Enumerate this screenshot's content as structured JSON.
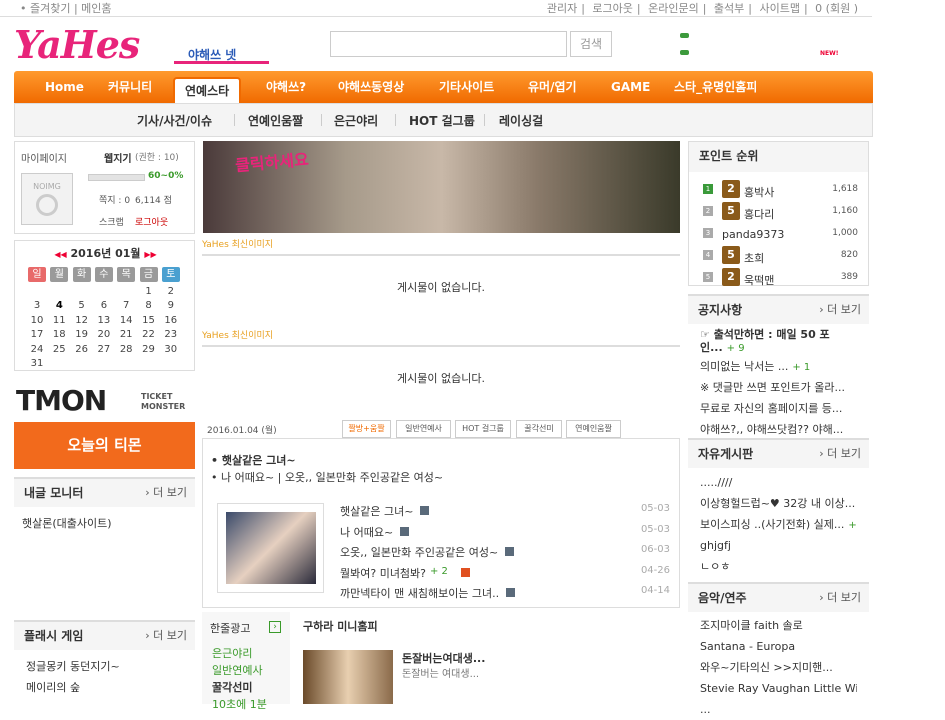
{
  "topbar": {
    "left": "• 즐겨찾기 | 메인홈",
    "right": [
      "관리자",
      "로그아웃",
      "온라인문의",
      "출석부",
      "사이트맵",
      "0 (회원 )"
    ]
  },
  "brand": {
    "logo": "YaHes",
    "sub": "야해쓰 넷"
  },
  "search": {
    "placeholder": "",
    "button": "검색"
  },
  "header_badge": "NEW!",
  "nav": [
    "Home",
    "커뮤니티",
    "연예스타",
    "야해쓰?",
    "야해쓰동영상",
    "기타사이트",
    "유머/엽기",
    "GAME",
    "스타_유명인홈피"
  ],
  "subnav": [
    "기사/사건/이슈",
    "연예인움짤",
    "은근야리",
    "HOT 걸그룹",
    "레이싱걸"
  ],
  "mypage": {
    "title": "마이페이지",
    "name": "웹지기",
    "perm": "(권한 : 10)",
    "noimg": "NOIMG",
    "percent": "60~0%",
    "point_label": "쪽지 : 0",
    "points": "6,114 점",
    "scrap": "스크랩",
    "logout": "로그아웃"
  },
  "calendar": {
    "title": "2016년 01월",
    "prev": "◀◀",
    "next": "▶▶",
    "dow": [
      "일",
      "월",
      "화",
      "수",
      "목",
      "금",
      "토"
    ],
    "days": [
      "",
      "",
      "",
      "",
      "",
      "1",
      "2",
      "3",
      "4",
      "5",
      "6",
      "7",
      "8",
      "9",
      "10",
      "11",
      "12",
      "13",
      "14",
      "15",
      "16",
      "17",
      "18",
      "19",
      "20",
      "21",
      "22",
      "23",
      "24",
      "25",
      "26",
      "27",
      "28",
      "29",
      "30",
      "31"
    ]
  },
  "tmon": {
    "logo": "TMON",
    "sub1": "TICKET",
    "sub2": "MONSTER",
    "button": "오늘의 티몬"
  },
  "monitor": {
    "title": "내글 모니터",
    "more": "› 더 보기",
    "items": [
      "햇살론(대출사이트)"
    ]
  },
  "flash": {
    "title": "플래시 게임",
    "more": "› 더 보기",
    "items": [
      "정글몽키 동던지기~",
      "메이리의 숲"
    ]
  },
  "banner": {
    "text": "클릭하세요"
  },
  "latest1": {
    "title": "YaHes 최신이미지",
    "empty": "게시물이 없습니다."
  },
  "latest2": {
    "title": "YaHes 최신이미지",
    "empty": "게시물이 없습니다."
  },
  "board": {
    "date": "2016.01.04 (월)",
    "tabs": [
      "짤방+움짤",
      "일반연예사",
      "HOT 걸그룹",
      "꿀각선미",
      "연예인움짤"
    ],
    "headline1": "• 햇살같은 그녀~",
    "headline2": "• 나 어때요~ | 오옷,, 일본만화 주인공같은 여성~",
    "rows": [
      {
        "title": "햇살같은 그녀~",
        "date": "05-03"
      },
      {
        "title": "나 어때요~",
        "date": "05-03"
      },
      {
        "title": "오옷,, 일본만화 주인공같은 여성~",
        "date": "06-03"
      },
      {
        "title": "뭘봐여? 미녀첨봐?",
        "count": "+ 2",
        "date": "04-26"
      },
      {
        "title": "까만넥타이 맨 새침해보이는 그녀..",
        "date": "04-14"
      }
    ]
  },
  "oneline": {
    "title": "한줄광고",
    "items": [
      "은근야리",
      "일반연예사",
      "꿀각선미",
      "10초에 1분"
    ]
  },
  "minihome": {
    "title": "구하라 미니홈피",
    "post_title": "돈잘버는여대생...",
    "post_desc": "돈잘버는 여대생..."
  },
  "ranking": {
    "title": "포인트 순위",
    "rows": [
      {
        "n": "1",
        "lv": "2",
        "name": "홍박사",
        "pt": "1,618"
      },
      {
        "n": "2",
        "lv": "5",
        "name": "홍다리",
        "pt": "1,160"
      },
      {
        "n": "3",
        "lv": "",
        "name": "panda9373",
        "pt": "1,000"
      },
      {
        "n": "4",
        "lv": "5",
        "name": "초희",
        "pt": "820"
      },
      {
        "n": "5",
        "lv": "2",
        "name": "욱떡맨",
        "pt": "389"
      }
    ]
  },
  "notice": {
    "title": "공지사항",
    "more": "› 더 보기",
    "items": [
      {
        "t": "☞ 출석만하면 : 매일 50 포인...",
        "c": "+ 9"
      },
      {
        "t": "의미없는 낙서는 ...",
        "c": "+ 1"
      },
      {
        "t": "※ 댓글만 쓰면 포인트가 올라..."
      },
      {
        "t": "무료로 자신의 홈페이지를 등..."
      },
      {
        "t": "야해쓰?,, 야해쓰닷컴?? 야해..."
      }
    ]
  },
  "free": {
    "title": "자유게시판",
    "more": "› 더 보기",
    "items": [
      {
        "t": ".....////"
      },
      {
        "t": "이상형헐드럽~♥ 32강 내 이상..."
      },
      {
        "t": "보이스피싱 ..(사기전화) 실제...",
        "c": "+ 1"
      },
      {
        "t": "ghjgfj"
      },
      {
        "t": "ㄴㅇㅎ"
      }
    ]
  },
  "music": {
    "title": "음악/연주",
    "more": "› 더 보기",
    "items": [
      "조지마이클 faith 솔로",
      "Santana - Europa",
      "와우~기타의신 >>지미핸...",
      "Stevie Ray Vaughan Little Wi...",
      "..."
    ]
  },
  "colors": {
    "orange": "#f47a10",
    "pink": "#e8247a"
  }
}
